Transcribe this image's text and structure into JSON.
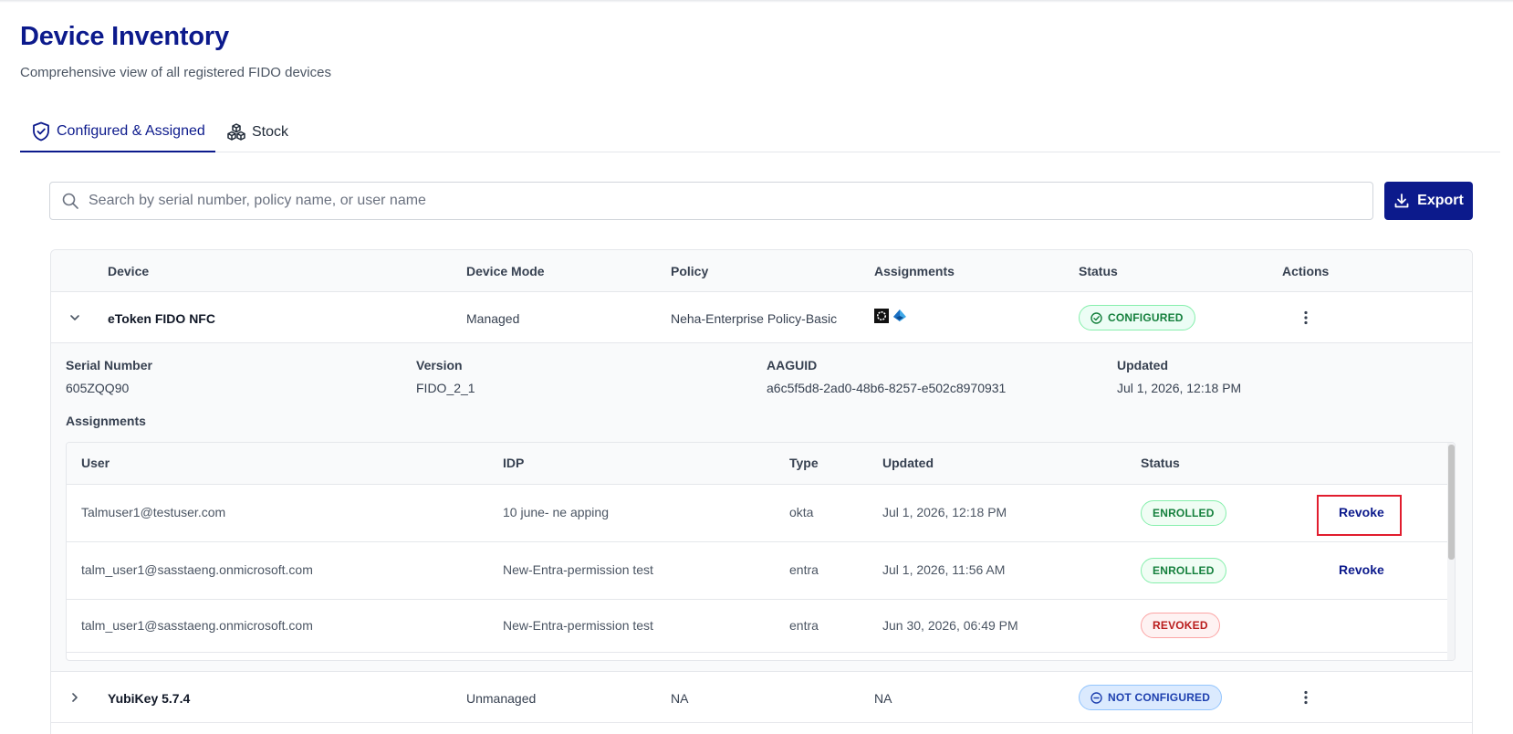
{
  "header": {
    "title": "Device Inventory",
    "subtitle": "Comprehensive view of all registered FIDO devices"
  },
  "tabs": [
    {
      "label": "Configured & Assigned",
      "icon": "shield-check-icon",
      "active": true
    },
    {
      "label": "Stock",
      "icon": "cubes-icon",
      "active": false
    }
  ],
  "search": {
    "placeholder": "Search by serial number, policy name, or user name",
    "value": ""
  },
  "export": {
    "label": "Export",
    "icon": "download-icon"
  },
  "colors": {
    "primary": "#0c1a8c",
    "success": "#15803d",
    "danger": "#b91c1c",
    "info": "#1e40af"
  },
  "table": {
    "headers": [
      "Device",
      "Device Mode",
      "Policy",
      "Assignments",
      "Status",
      "Actions"
    ],
    "rows": [
      {
        "device": "eToken FIDO NFC",
        "mode": "Managed",
        "policy": "Neha-Enterprise Policy-Basic",
        "assignment_icons": [
          "okta-logo-icon",
          "entra-logo-icon"
        ],
        "status": "CONFIGURED",
        "expanded": true
      },
      {
        "device": "YubiKey 5.7.4",
        "mode": "Unmanaged",
        "policy": "NA",
        "assignments": "NA",
        "status": "NOT CONFIGURED",
        "expanded": false
      }
    ]
  },
  "details": {
    "serial_label": "Serial Number",
    "serial": "605ZQQ90",
    "version_label": "Version",
    "version": "FIDO_2_1",
    "aaguid_label": "AAGUID",
    "aaguid": "a6c5f5d8-2ad0-48b6-8257-e502c8970931",
    "updated_label": "Updated",
    "updated": "Jul 1, 2026, 12:18 PM",
    "assignments_label": "Assignments",
    "assignments_headers": [
      "User",
      "IDP",
      "Type",
      "Updated",
      "Status"
    ],
    "assignments": [
      {
        "user": "Talmuser1@testuser.com",
        "idp": "10 june- ne apping",
        "type": "okta",
        "updated": "Jul 1, 2026, 12:18 PM",
        "status": "ENROLLED",
        "action": "Revoke"
      },
      {
        "user": "talm_user1@sasstaeng.onmicrosoft.com",
        "idp": "New-Entra-permission test",
        "type": "entra",
        "updated": "Jul 1, 2026, 11:56 AM",
        "status": "ENROLLED",
        "action": "Revoke"
      },
      {
        "user": "talm_user1@sasstaeng.onmicrosoft.com",
        "idp": "New-Entra-permission test",
        "type": "entra",
        "updated": "Jun 30, 2026, 06:49 PM",
        "status": "REVOKED",
        "action": ""
      }
    ]
  }
}
